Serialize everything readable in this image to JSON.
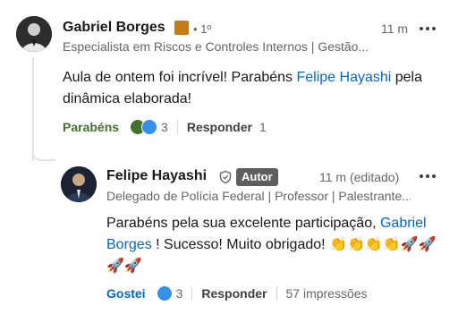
{
  "comment": {
    "author": "Gabriel Borges",
    "badge_letters": "in",
    "degree": "• 1º",
    "time": "11 m",
    "headline": "Especialista em Riscos e Controles Internos | Gestão...",
    "text_before": "Aula de ontem foi incrível! Parabéns ",
    "mention": "Felipe Hayashi",
    "text_after": " pela dinâmica elaborada!",
    "reaction_label": "Parabéns",
    "reaction_icons": [
      "celebrate-icon",
      "like-icon"
    ],
    "reaction_count": "3",
    "reply_label": "Responder",
    "reply_count": "1"
  },
  "reply": {
    "author": "Felipe Hayashi",
    "author_tag": "Autor",
    "time": "11 m (editado)",
    "headline": "Delegado de Polícia Federal | Professor | Palestrante...",
    "text_before": "Parabéns pela sua excelente participação, ",
    "mention": "Gabriel Borges",
    "text_after": " ! Sucesso! Muito obrigado! 👏👏👏👏🚀🚀🚀🚀",
    "reaction_label": "Gostei",
    "reaction_icons": [
      "like-icon"
    ],
    "reaction_count": "3",
    "reply_label": "Responder",
    "impressions": "57 impressões"
  },
  "colors": {
    "link": "#0a66c2",
    "celebrate": "#44712e",
    "like": "#378fe9",
    "author_tag_bg": "#5e5e5e",
    "linkedin_badge": "#c37d16"
  }
}
